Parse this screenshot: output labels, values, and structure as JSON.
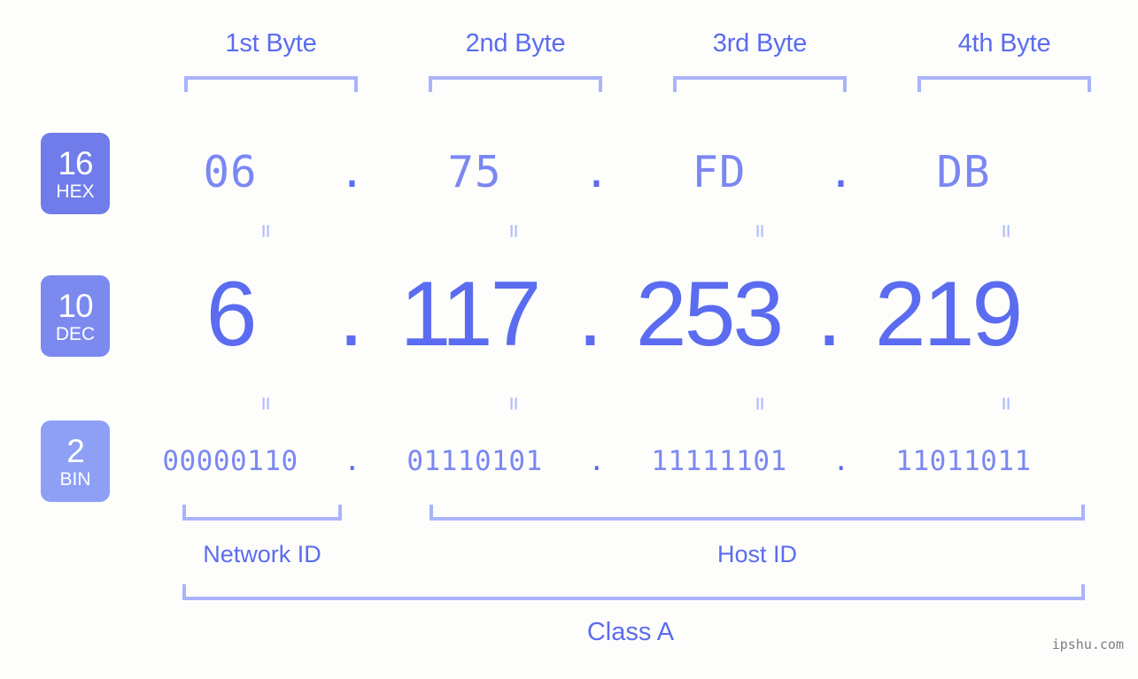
{
  "page": {
    "background_color": "#fdfefb",
    "accent_color": "#5b6cf0",
    "light_accent_color": "#aab4fb"
  },
  "byte_headers": [
    {
      "label": "1st Byte"
    },
    {
      "label": "2nd Byte"
    },
    {
      "label": "3rd Byte"
    },
    {
      "label": "4th Byte"
    }
  ],
  "radix_badges": [
    {
      "number": "16",
      "name": "HEX",
      "color": "#6f7ce9"
    },
    {
      "number": "10",
      "name": "DEC",
      "color": "#7c89ee"
    },
    {
      "number": "2",
      "name": "BIN",
      "color": "#8ea0f6"
    }
  ],
  "rows": {
    "hex": {
      "values": [
        "06",
        "75",
        "FD",
        "DB"
      ],
      "separator": "."
    },
    "dec": {
      "values": [
        "6",
        "117",
        "253",
        "219"
      ],
      "separator": "."
    },
    "bin": {
      "values": [
        "00000110",
        "01110101",
        "11111101",
        "11011011"
      ],
      "separator": "."
    }
  },
  "equals_marks": {
    "glyph": "=",
    "count_per_gap": 4
  },
  "segments": {
    "network_id": "Network ID",
    "host_id": "Host ID"
  },
  "class_label": "Class A",
  "watermark": "ipshu.com"
}
